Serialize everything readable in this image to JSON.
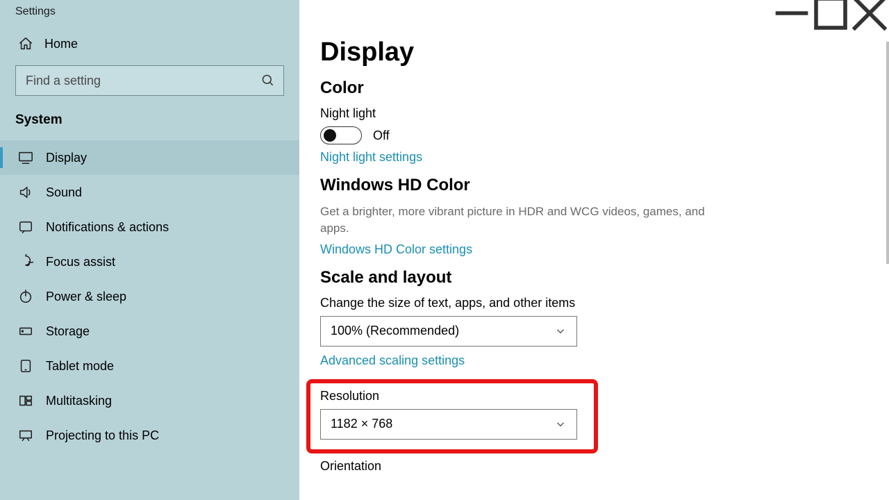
{
  "window": {
    "title": "Settings"
  },
  "sidebar": {
    "home": "Home",
    "search_placeholder": "Find a setting",
    "category": "System",
    "items": [
      {
        "label": "Display",
        "active": true
      },
      {
        "label": "Sound"
      },
      {
        "label": "Notifications & actions"
      },
      {
        "label": "Focus assist"
      },
      {
        "label": "Power & sleep"
      },
      {
        "label": "Storage"
      },
      {
        "label": "Tablet mode"
      },
      {
        "label": "Multitasking"
      },
      {
        "label": "Projecting to this PC"
      }
    ]
  },
  "main": {
    "title": "Display",
    "color": {
      "heading": "Color",
      "night_light_label": "Night light",
      "night_light_state": "Off",
      "night_light_link": "Night light settings"
    },
    "hd": {
      "heading": "Windows HD Color",
      "desc": "Get a brighter, more vibrant picture in HDR and WCG videos, games, and apps.",
      "link": "Windows HD Color settings"
    },
    "scale": {
      "heading": "Scale and layout",
      "text_size_label": "Change the size of text, apps, and other items",
      "text_size_value": "100% (Recommended)",
      "adv_link": "Advanced scaling settings",
      "resolution_label": "Resolution",
      "resolution_value": "1182 × 768",
      "orientation_label": "Orientation"
    }
  }
}
